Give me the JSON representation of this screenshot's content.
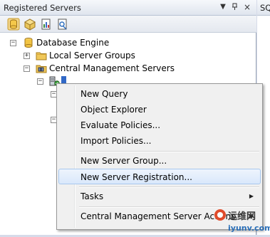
{
  "window": {
    "title": "Registered Servers",
    "controls": [
      "▼",
      "ₓ",
      "×"
    ]
  },
  "right_pane": {
    "tab_label": "SQ"
  },
  "toolbar": {
    "buttons": [
      "database-engine",
      "analysis-services",
      "reporting-services",
      "integration-services"
    ]
  },
  "tree": {
    "root": {
      "label": "Database Engine",
      "expander": "−"
    },
    "local_groups": {
      "label": "Local Server Groups",
      "expander": "+"
    },
    "cms": {
      "label": "Central Management Servers",
      "expander": "−"
    },
    "server": {
      "label": "",
      "expander": "−"
    },
    "child_a": {
      "expander": "−"
    },
    "child_b": {
      "expander": "−"
    }
  },
  "context_menu": {
    "items": [
      {
        "label": "New Query",
        "highlighted": false
      },
      {
        "label": "Object Explorer",
        "highlighted": false
      },
      {
        "label": "Evaluate Policies...",
        "highlighted": false
      },
      {
        "label": "Import Policies...",
        "highlighted": false
      },
      {
        "label": "New Server Group...",
        "highlighted": false
      },
      {
        "label": "New Server Registration...",
        "highlighted": true
      },
      {
        "label": "Tasks",
        "submenu": true
      },
      {
        "label": "Central Management Server Actions",
        "submenu": true
      }
    ],
    "submenu_arrow": "▶"
  },
  "watermark": {
    "text_cn": "运维网",
    "text_url": "iyunv.com"
  }
}
